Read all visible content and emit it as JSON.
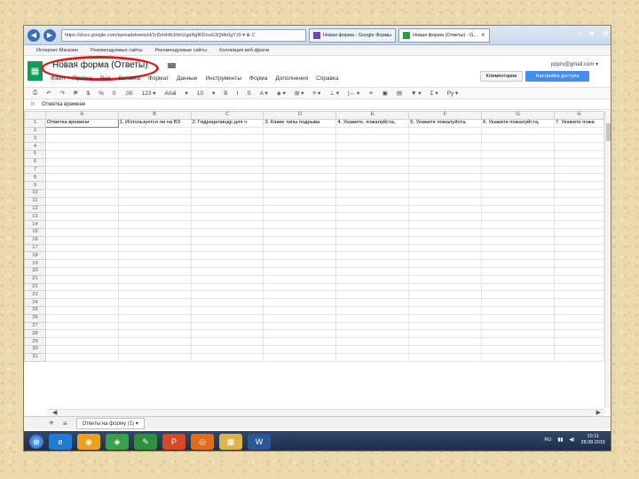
{
  "browser": {
    "address": "https://docs.google.com/spreadsheets/d/1rj5rHHRJrbhUgaNglRDnuG3QHk0gYJ0 ▾ ⊕ C",
    "tabs": [
      {
        "label": "Новая форма - Google Формы"
      },
      {
        "label": "Новая форма (Ответы) - G..."
      }
    ]
  },
  "bookmarks": [
    "Интернет-Магазин",
    "Рекомендуемые сайты",
    "Рекомендуемые сайты",
    "Коллекция веб-фрагм"
  ],
  "app": {
    "title": "Новая форма (Ответы)",
    "menu": [
      "Файл",
      "Правка",
      "Вид",
      "Вставка",
      "Формат",
      "Данные",
      "Инструменты",
      "Форма",
      "Дополнения",
      "Справка"
    ],
    "user_email": "рррrx@gmail.com ▾",
    "comments_label": "Комментарии",
    "access_label": "Настройки доступа",
    "toolbar": [
      "⎙",
      "↶",
      "↷",
      "₱",
      "$",
      "%",
      "0",
      ".00",
      "123 ▾",
      "Arial",
      "▾",
      "10",
      "▾",
      "B",
      "I",
      "S",
      "A ▾",
      "◈ ▾",
      "⊞ ▾",
      "≡ ▾",
      "⊥ ▾",
      "|↔ ▾",
      "⚭",
      "▣",
      "▤",
      "▼ ▾",
      "Σ ▾",
      "Ру ▾"
    ],
    "formula_value": "Отметка времени"
  },
  "grid": {
    "columns": [
      "A",
      "B",
      "C",
      "D",
      "E",
      "F",
      "G",
      "H"
    ],
    "header_row": [
      "Отметка времени",
      "1. Используется ли на ВЗ",
      "2. Гидроцилиндр для ч",
      "3. Какие типы подрыва",
      "4. Укажите, пожалуйста,",
      "5. Укажите пожалуйста,",
      "6. Укажите пожалуйста,",
      "7. Укажите пожа"
    ],
    "row_numbers": [
      "1",
      "2",
      "3",
      "4",
      "5",
      "6",
      "7",
      "8",
      "9",
      "10",
      "11",
      "12",
      "13",
      "14",
      "15",
      "16",
      "17",
      "18",
      "19",
      "20",
      "21",
      "22",
      "23",
      "24",
      "25",
      "26",
      "27",
      "28",
      "29",
      "30",
      "31"
    ]
  },
  "sheet_tab_label": "Ответы на форму (1) ▾",
  "taskbar": {
    "apps": [
      "e",
      "◉",
      "◈",
      "✎",
      "P",
      "◎",
      "▦",
      "W"
    ],
    "lang": "RU",
    "time": "10:11",
    "date": "28.08.2015"
  }
}
